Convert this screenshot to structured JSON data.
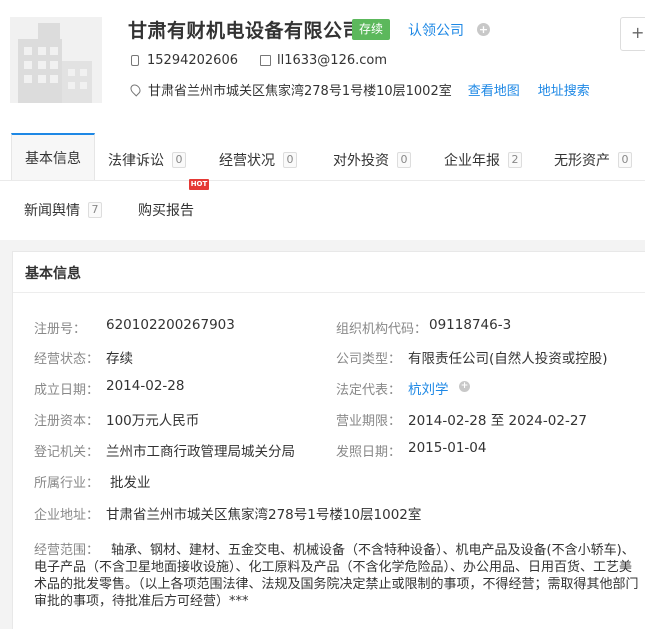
{
  "company": {
    "name": "甘肃有财机电设备有限公司",
    "status": "存续",
    "claim_label": "认领公司",
    "add_label": "+",
    "phone": "15294202606",
    "email": "ll1633@126.com",
    "address": "甘肃省兰州市城关区焦家湾278号1号楼10层1002室",
    "view_map_label": "查看地图",
    "address_search_label": "地址搜索"
  },
  "tabs": [
    {
      "label": "基本信息",
      "count": ""
    },
    {
      "label": "法律诉讼",
      "count": "0"
    },
    {
      "label": "经营状况",
      "count": "0"
    },
    {
      "label": "对外投资",
      "count": "0"
    },
    {
      "label": "企业年报",
      "count": "2"
    },
    {
      "label": "无形资产",
      "count": "0"
    },
    {
      "label": "新闻舆情",
      "count": "7"
    },
    {
      "label": "购买报告",
      "count": "",
      "badge": "HOT"
    }
  ],
  "panel": {
    "title": "基本信息",
    "fields": {
      "reg_no_label": "注册号：",
      "reg_no": "620102200267903",
      "org_code_label": "组织机构代码：",
      "org_code": "09118746-3",
      "biz_status_label": "经营状态：",
      "biz_status": "存续",
      "company_type_label": "公司类型：",
      "company_type": "有限责任公司(自然人投资或控股)",
      "founded_label": "成立日期：",
      "founded": "2014-02-28",
      "legal_rep_label": "法定代表：",
      "legal_rep": "杭刘学",
      "capital_label": "注册资本：",
      "capital": "100万元人民币",
      "term_label": "营业期限：",
      "term": "2014-02-28 至 2024-02-27",
      "authority_label": "登记机关：",
      "authority": "兰州市工商行政管理局城关分局",
      "issue_date_label": "发照日期：",
      "issue_date": "2015-01-04",
      "industry_label": "所属行业：",
      "industry": "批发业",
      "address_label": "企业地址：",
      "address": "甘肃省兰州市城关区焦家湾278号1号楼10层1002室",
      "scope_label": "经营范围：",
      "scope": "轴承、钢材、建材、五金交电、机械设备（不含特种设备）、机电产品及设备(不含小轿车)、电子产品（不含卫星地面接收设施）、化工原料及产品（不含化学危险品）、办公用品、日用百货、工艺美术品的批发零售。（以上各项范围法律、法规及国务院决定禁止或限制的事项，不得经营；需取得其他部门审批的事项，待批准后方可经营）***"
    }
  }
}
